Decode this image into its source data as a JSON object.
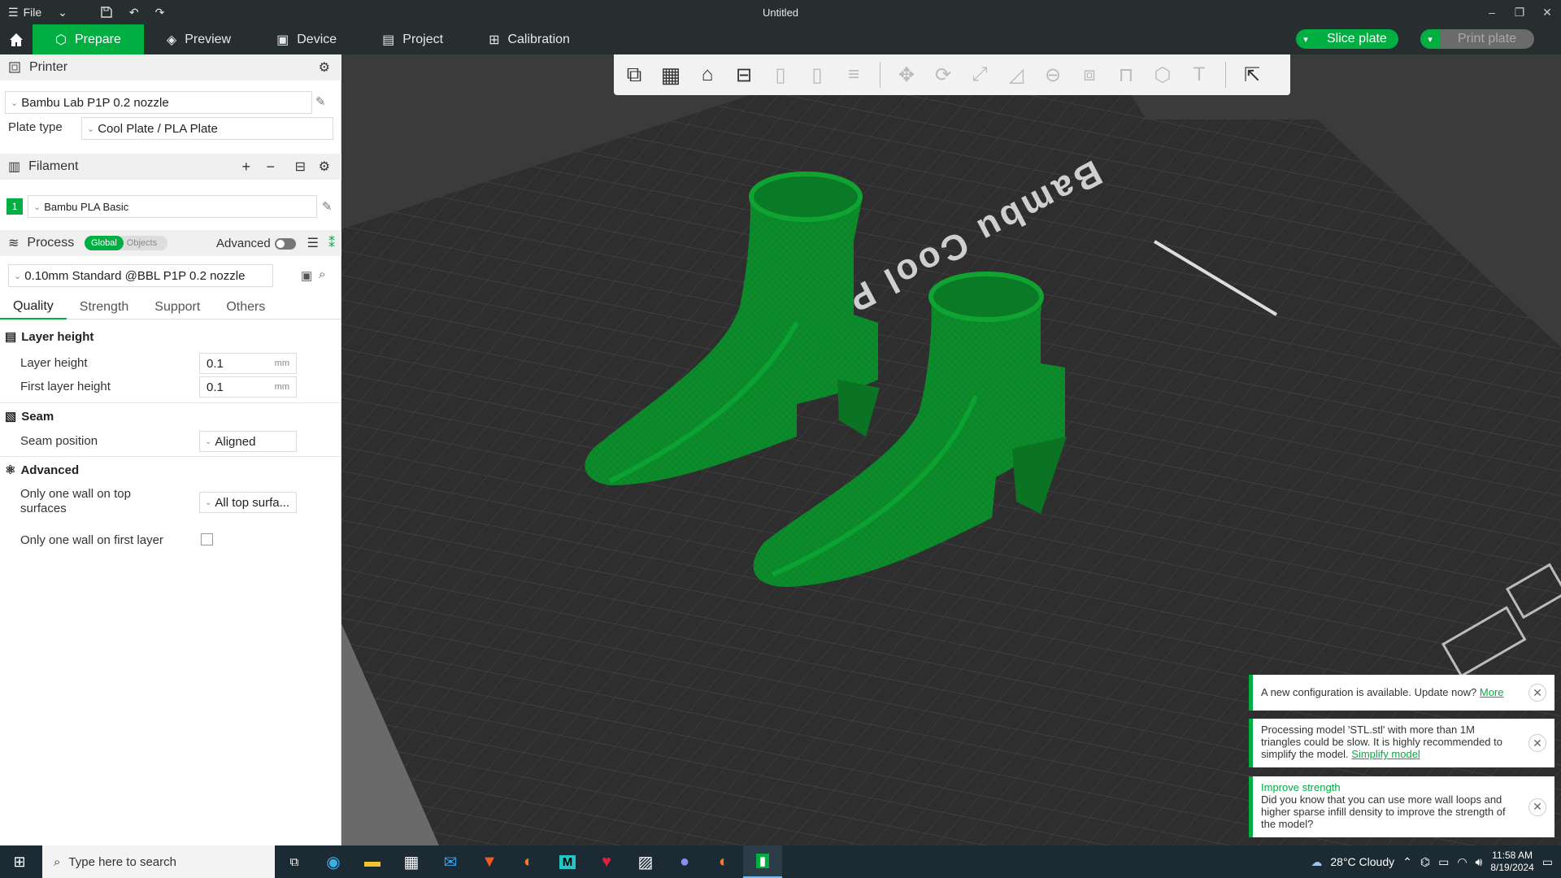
{
  "titlebar": {
    "file_label": "File",
    "title": "Untitled"
  },
  "nav": {
    "tabs": [
      {
        "label": "Prepare"
      },
      {
        "label": "Preview"
      },
      {
        "label": "Device"
      },
      {
        "label": "Project"
      },
      {
        "label": "Calibration"
      }
    ],
    "slice_label": "Slice plate",
    "print_label": "Print plate"
  },
  "sidebar": {
    "printer": {
      "header": "Printer",
      "preset": "Bambu Lab P1P 0.2 nozzle",
      "plate_type_label": "Plate type",
      "plate_type_value": "Cool Plate / PLA Plate"
    },
    "filament": {
      "header": "Filament",
      "index": "1",
      "preset": "Bambu PLA Basic"
    },
    "process": {
      "header": "Process",
      "toggle_global": "Global",
      "toggle_objects": "Objects",
      "advanced_label": "Advanced",
      "preset": "0.10mm Standard @BBL P1P 0.2 nozzle"
    },
    "tabs": [
      "Quality",
      "Strength",
      "Support",
      "Others"
    ],
    "groups": {
      "layer_height": {
        "title": "Layer height",
        "layer_height_label": "Layer height",
        "layer_height_value": "0.1",
        "first_layer_label": "First layer height",
        "first_layer_value": "0.1",
        "unit": "mm"
      },
      "seam": {
        "title": "Seam",
        "position_label": "Seam position",
        "position_value": "Aligned"
      },
      "advanced": {
        "title": "Advanced",
        "top_wall_label_1": "Only one wall on top",
        "top_wall_label_2": "surfaces",
        "top_wall_value": "All top surfa...",
        "first_layer_wall_label": "Only one wall on first layer"
      }
    }
  },
  "plate": {
    "brand_text": "Bambu Cool Plate"
  },
  "notifications": [
    {
      "text": "A new configuration is available. Update now?",
      "link": "More"
    },
    {
      "text": "Processing model 'STL.stl' with more than 1M triangles could be slow. It is highly recommended to simplify the model.",
      "link": "Simplify model"
    },
    {
      "title": "Improve strength",
      "text": "Did you know that you can use more wall loops and higher sparse infill density to improve the strength of the model?"
    }
  ],
  "taskbar": {
    "search_placeholder": "Type here to search",
    "weather": "28°C  Cloudy",
    "time": "11:58 AM",
    "date": "8/19/2024"
  },
  "colors": {
    "accent": "#00ae42",
    "titlebar_bg": "#262e30",
    "model": "#0a8a2a",
    "bed": "#2e2e2e"
  }
}
